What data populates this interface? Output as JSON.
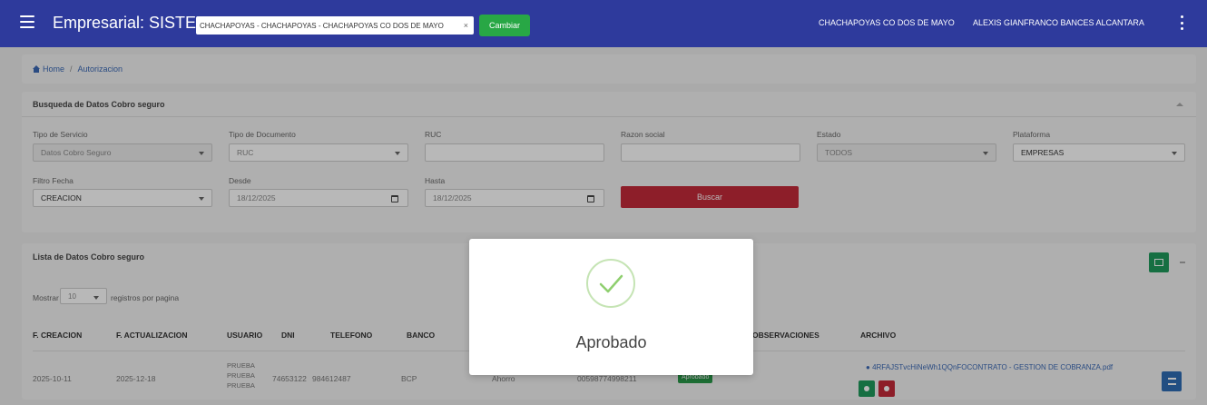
{
  "header": {
    "title": "Empresarial: SISTEMAS",
    "branch_select": "CHACHAPOYAS - CHACHAPOYAS - CHACHAPOYAS CO DOS DE MAYO",
    "change_button": "Cambiar",
    "branch_name": "CHACHAPOYAS CO DOS DE MAYO",
    "user_name": "ALEXIS GIANFRANCO BANCES ALCANTARA"
  },
  "breadcrumb": {
    "home": "Home",
    "current": "Autorizacion"
  },
  "search": {
    "title": "Busqueda de Datos Cobro seguro",
    "fields": {
      "tipo_servicio": {
        "label": "Tipo de Servicio",
        "value": "Datos Cobro Seguro"
      },
      "tipo_documento": {
        "label": "Tipo de Documento",
        "value": "RUC"
      },
      "ruc": {
        "label": "RUC",
        "value": ""
      },
      "razon_social": {
        "label": "Razon social",
        "value": ""
      },
      "estado": {
        "label": "Estado",
        "value": "TODOS"
      },
      "plataforma": {
        "label": "Plataforma",
        "value": "EMPRESAS"
      },
      "filtro_fecha": {
        "label": "Filtro Fecha",
        "value": "CREACION"
      },
      "desde": {
        "label": "Desde",
        "value": "18/12/2025"
      },
      "hasta": {
        "label": "Hasta",
        "value": "18/12/2025"
      }
    },
    "search_button": "Buscar"
  },
  "list": {
    "title": "Lista de Datos Cobro seguro",
    "show_label": "Mostrar",
    "page_size": "10",
    "per_page_label": "registros por pagina",
    "columns": [
      "F. CREACION",
      "F. ACTUALIZACION",
      "USUARIO",
      "DNI",
      "TELEFONO",
      "BANCO",
      "OBSERVACIONES",
      "ARCHIVO"
    ],
    "rows": [
      {
        "created": "2025-10-11",
        "updated": "2025-12-18",
        "user_lines": [
          "PRUEBA",
          "PRUEBA",
          "PRUEBA"
        ],
        "dni": "74653122",
        "phone": "984612487",
        "bank": "BCP",
        "account_type": "Ahorro",
        "account": "00598774998211",
        "status": "Aprobado",
        "file": "4RFAJSTvcHiNeWh1QQnFOCONTRATO - GESTION DE COBRANZA.pdf"
      }
    ]
  },
  "modal": {
    "title": "Aprobado"
  },
  "colors": {
    "primary": "#2e3a9c",
    "success": "#28a745",
    "danger": "#c42a3a",
    "link": "#3b69b5"
  }
}
